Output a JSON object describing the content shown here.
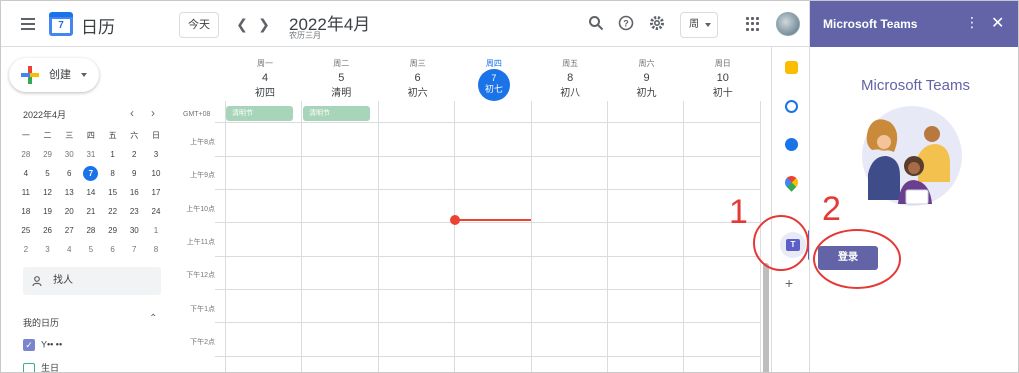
{
  "header": {
    "app_title": "日历",
    "logo_day": "7",
    "today_button": "今天",
    "prev_icon": "chevron-left-icon",
    "next_icon": "chevron-right-icon",
    "month_title": "2022年4月",
    "lunar_month": "农历三月",
    "view_selector": "周"
  },
  "sidebar": {
    "create_label": "创建",
    "mini_calendar": {
      "title": "2022年4月",
      "weekdays": [
        "一",
        "二",
        "三",
        "四",
        "五",
        "六",
        "日"
      ],
      "weeks": [
        [
          "28",
          "29",
          "30",
          "31",
          "1",
          "2",
          "3"
        ],
        [
          "4",
          "5",
          "6",
          "7",
          "8",
          "9",
          "10"
        ],
        [
          "11",
          "12",
          "13",
          "14",
          "15",
          "16",
          "17"
        ],
        [
          "18",
          "19",
          "20",
          "21",
          "22",
          "23",
          "24"
        ],
        [
          "25",
          "26",
          "27",
          "28",
          "29",
          "30",
          "1"
        ],
        [
          "2",
          "3",
          "4",
          "5",
          "6",
          "7",
          "8"
        ]
      ],
      "selected": "7"
    },
    "find_people_placeholder": "找人",
    "my_calendars_title": "我的日历",
    "calendars": [
      {
        "name": "Y•• ••",
        "checked": true,
        "color": "#7986cb"
      },
      {
        "name": "生日",
        "checked": false,
        "color": "#33b679"
      }
    ]
  },
  "week": {
    "timezone": "GMT+08",
    "days": [
      {
        "weekday": "周一",
        "date": "4",
        "lunar": "初四"
      },
      {
        "weekday": "周二",
        "date": "5",
        "lunar": "清明"
      },
      {
        "weekday": "周三",
        "date": "6",
        "lunar": "初六"
      },
      {
        "weekday": "周四",
        "date": "7",
        "lunar": "初七",
        "today": true
      },
      {
        "weekday": "周五",
        "date": "8",
        "lunar": "初八"
      },
      {
        "weekday": "周六",
        "date": "9",
        "lunar": "初九"
      },
      {
        "weekday": "周日",
        "date": "10",
        "lunar": "初十"
      }
    ],
    "all_day_events": [
      {
        "title": "清明节",
        "day": "周一"
      },
      {
        "title": "清明节",
        "day": "周二"
      }
    ],
    "time_labels": [
      "上午8点",
      "上午9点",
      "上午10点",
      "上午11点",
      "下午12点",
      "下午1点",
      "下午2点"
    ]
  },
  "side_strip": {
    "icons": [
      "keep-icon",
      "tasks-icon",
      "contacts-icon",
      "maps-icon",
      "teams-icon",
      "add-icon"
    ]
  },
  "teams_panel": {
    "header_title": "Microsoft Teams",
    "brand": "Microsoft Teams",
    "signin_button": "登录"
  },
  "annotations": {
    "label_1": "1",
    "label_2": "2",
    "color": "#e53935"
  },
  "colors": {
    "accent": "#1a73e8",
    "teams": "#6264a7",
    "now_line": "#ea4335",
    "holiday": "#a8d5ba"
  }
}
